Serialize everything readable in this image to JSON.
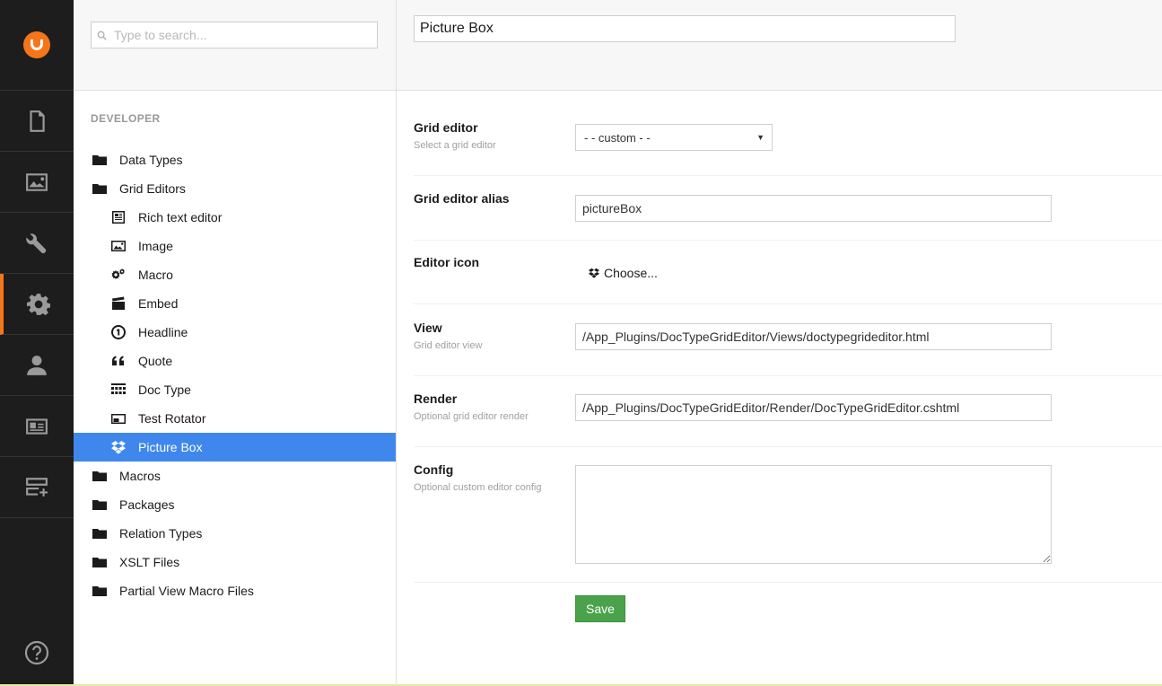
{
  "rail": {
    "items": [
      {
        "name": "content-section",
        "icon": "document-icon"
      },
      {
        "name": "media-section",
        "icon": "image-icon"
      },
      {
        "name": "settings-section",
        "icon": "wrench-icon"
      },
      {
        "name": "developer-section",
        "icon": "gear-icon",
        "active": true
      },
      {
        "name": "users-section",
        "icon": "user-icon"
      },
      {
        "name": "members-section",
        "icon": "id-card-icon"
      },
      {
        "name": "forms-section",
        "icon": "server-add-icon"
      }
    ],
    "help_icon": "help-icon",
    "accent_color": "#f5761a"
  },
  "tree": {
    "search_placeholder": "Type to search...",
    "section_title": "DEVELOPER",
    "items": [
      {
        "label": "Data Types",
        "icon": "folder-icon",
        "level": 0
      },
      {
        "label": "Grid Editors",
        "icon": "folder-icon",
        "level": 0
      },
      {
        "label": "Rich text editor",
        "icon": "rich-text-icon",
        "level": 1
      },
      {
        "label": "Image",
        "icon": "image-icon",
        "level": 1
      },
      {
        "label": "Macro",
        "icon": "cogs-icon",
        "level": 1
      },
      {
        "label": "Embed",
        "icon": "clapper-icon",
        "level": 1
      },
      {
        "label": "Headline",
        "icon": "headline-icon",
        "level": 1
      },
      {
        "label": "Quote",
        "icon": "quote-icon",
        "level": 1
      },
      {
        "label": "Doc Type",
        "icon": "grid-icon",
        "level": 1
      },
      {
        "label": "Test Rotator",
        "icon": "window-icon",
        "level": 1
      },
      {
        "label": "Picture Box",
        "icon": "dropbox-icon",
        "level": 1,
        "selected": true
      },
      {
        "label": "Macros",
        "icon": "folder-icon",
        "level": 0
      },
      {
        "label": "Packages",
        "icon": "folder-icon",
        "level": 0
      },
      {
        "label": "Relation Types",
        "icon": "folder-icon",
        "level": 0
      },
      {
        "label": "XSLT Files",
        "icon": "folder-icon",
        "level": 0
      },
      {
        "label": "Partial View Macro Files",
        "icon": "folder-icon",
        "level": 0
      }
    ],
    "selected_color": "#3f87ed"
  },
  "editor": {
    "name_value": "Picture Box",
    "properties": {
      "grid_editor": {
        "label": "Grid editor",
        "description": "Select a grid editor",
        "value": "- - custom - -"
      },
      "alias": {
        "label": "Grid editor alias",
        "value": "pictureBox"
      },
      "icon": {
        "label": "Editor icon",
        "choose_label": "Choose...",
        "icon": "dropbox-icon"
      },
      "view": {
        "label": "View",
        "description": "Grid editor view",
        "value": "/App_Plugins/DocTypeGridEditor/Views/doctypegrideditor.html"
      },
      "render": {
        "label": "Render",
        "description": "Optional grid editor render",
        "value": "/App_Plugins/DocTypeGridEditor/Render/DocTypeGridEditor.cshtml"
      },
      "config": {
        "label": "Config",
        "description": "Optional custom editor config",
        "value": ""
      }
    },
    "save_label": "Save",
    "save_color": "#4aa34a"
  }
}
